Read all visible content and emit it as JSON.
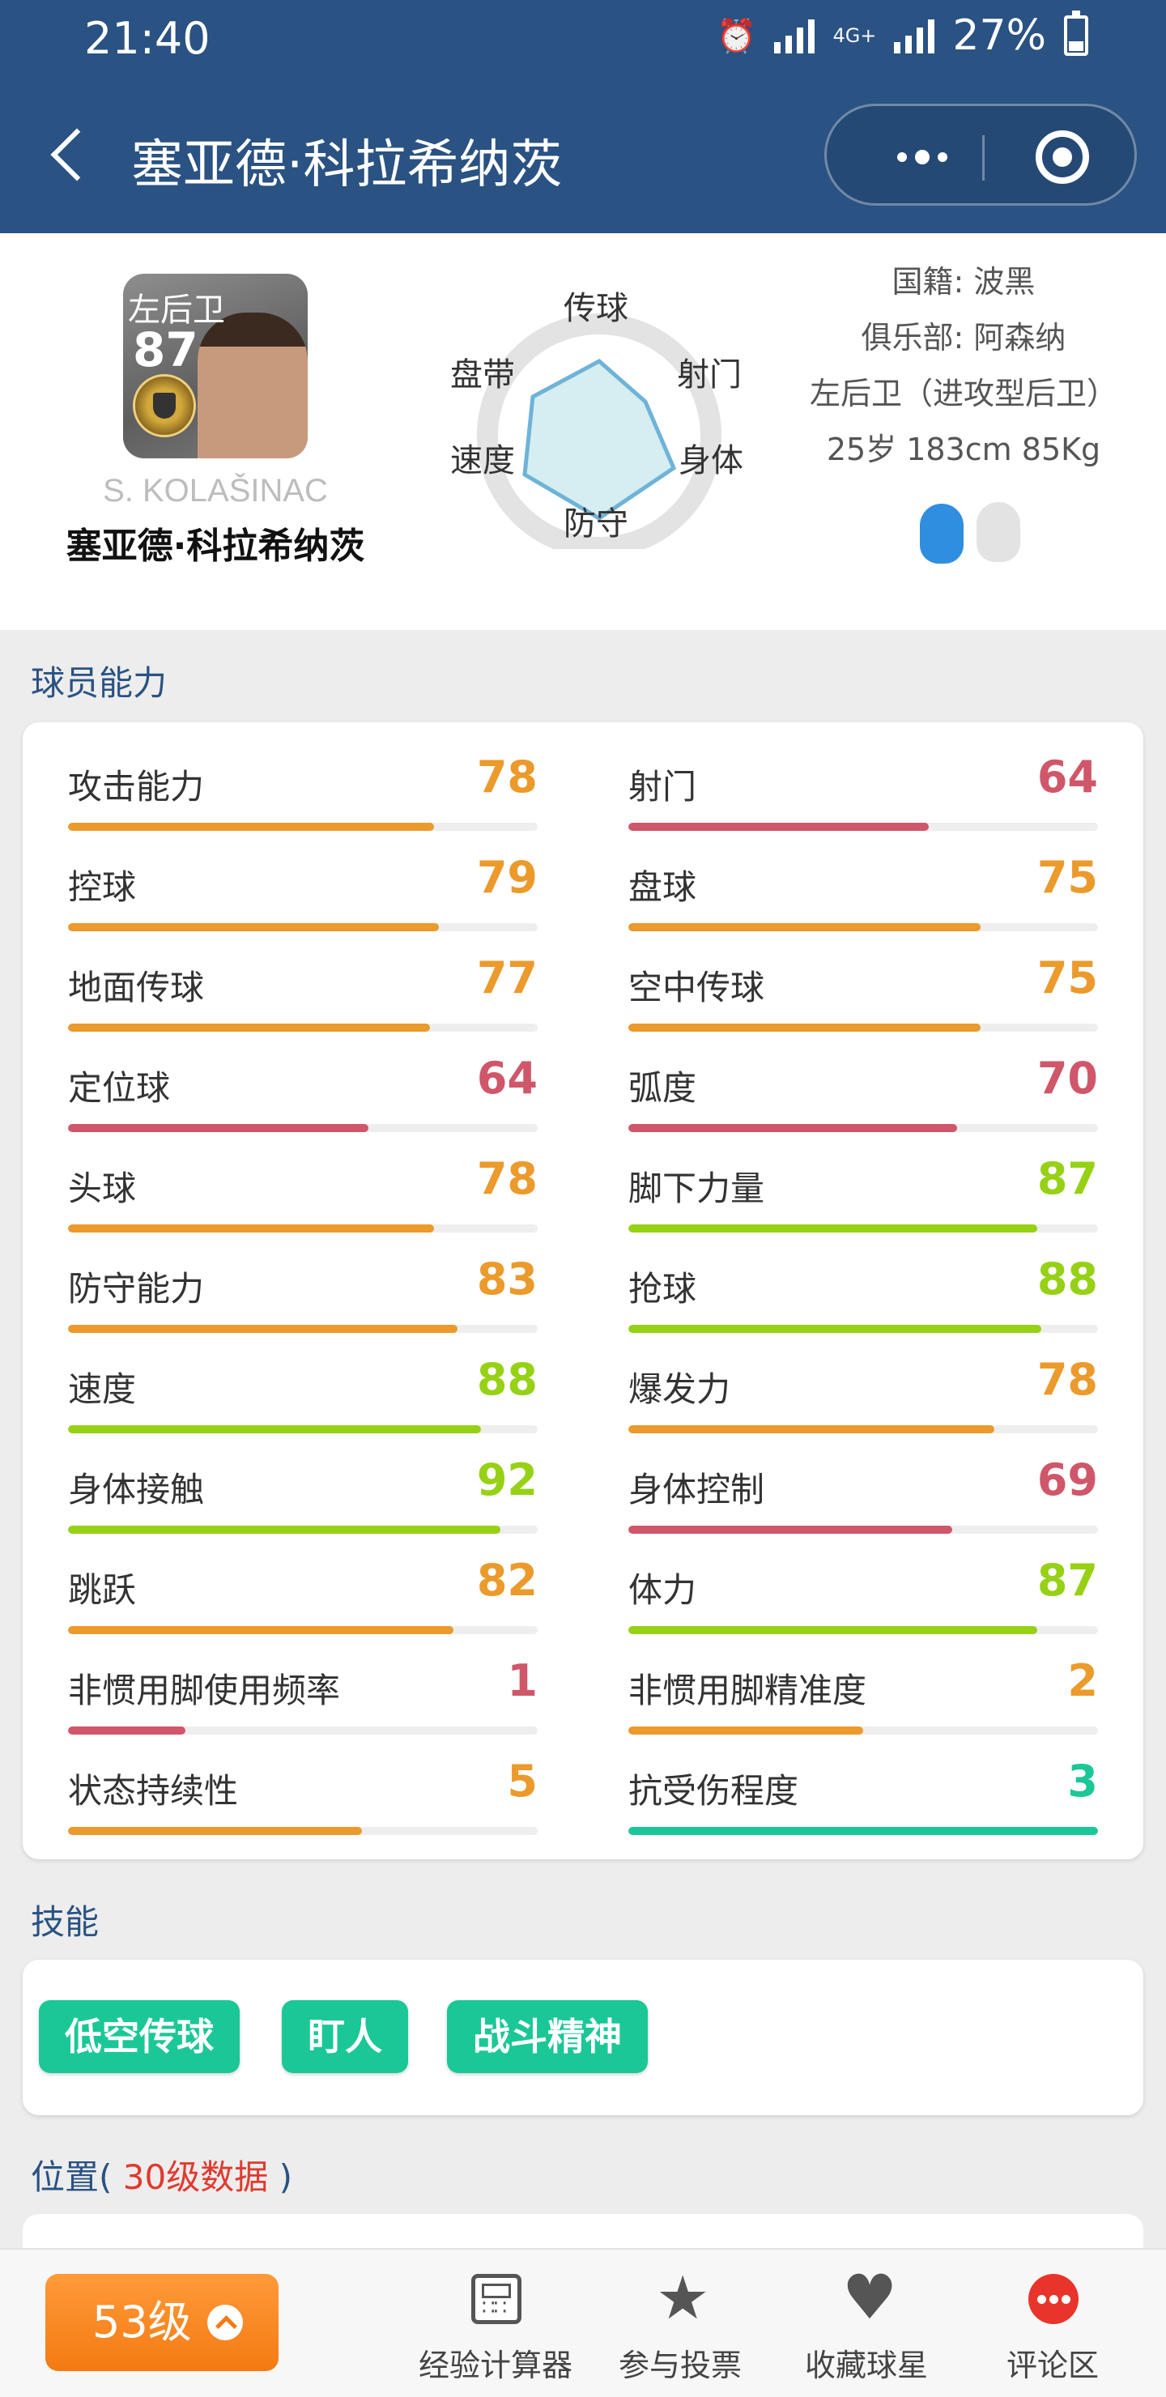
{
  "status": {
    "time": "21:40",
    "battery": "27%",
    "network": "4G+"
  },
  "header": {
    "title": "塞亚德·科拉希纳茨"
  },
  "player": {
    "card_position": "左后卫",
    "overall": "87",
    "name_en": "S. KOLAŠINAC",
    "name_cn": "塞亚德·科拉希纳茨",
    "nationality": "国籍: 波黑",
    "club": "俱乐部: 阿森纳",
    "position_detail": "左后卫（进攻型后卫）",
    "physical": "25岁 183cm 85Kg",
    "foot_icons": [
      "left-foot-icon",
      "right-foot-icon"
    ],
    "radar_labels": {
      "top": "传球",
      "upper_right": "射门",
      "lower_right": "身体",
      "bottom": "防守",
      "lower_left": "速度",
      "upper_left": "盘带"
    }
  },
  "sections": {
    "abilities": "球员能力",
    "skills": "技能",
    "position_prefix": "位置(",
    "position_tag": "30级数据",
    "position_suffix": ")"
  },
  "colors": {
    "orange": "#eb9a2b",
    "red": "#d0566a",
    "green": "#96d116",
    "teal": "#1bc797",
    "header": "#2a5283"
  },
  "stats": {
    "left": [
      {
        "name": "攻击能力",
        "value": "78",
        "fill": 0.78,
        "color": "orange"
      },
      {
        "name": "控球",
        "value": "79",
        "fill": 0.79,
        "color": "orange"
      },
      {
        "name": "地面传球",
        "value": "77",
        "fill": 0.77,
        "color": "orange"
      },
      {
        "name": "定位球",
        "value": "64",
        "fill": 0.64,
        "color": "red"
      },
      {
        "name": "头球",
        "value": "78",
        "fill": 0.78,
        "color": "orange"
      },
      {
        "name": "防守能力",
        "value": "83",
        "fill": 0.83,
        "color": "orange"
      },
      {
        "name": "速度",
        "value": "88",
        "fill": 0.88,
        "color": "green"
      },
      {
        "name": "身体接触",
        "value": "92",
        "fill": 0.92,
        "color": "green"
      },
      {
        "name": "跳跃",
        "value": "82",
        "fill": 0.82,
        "color": "orange"
      },
      {
        "name": "非惯用脚使用频率",
        "value": "1",
        "fill": 0.25,
        "color": "red"
      },
      {
        "name": "状态持续性",
        "value": "5",
        "fill": 0.625,
        "color": "orange"
      }
    ],
    "right": [
      {
        "name": "射门",
        "value": "64",
        "fill": 0.64,
        "color": "red"
      },
      {
        "name": "盘球",
        "value": "75",
        "fill": 0.75,
        "color": "orange"
      },
      {
        "name": "空中传球",
        "value": "75",
        "fill": 0.75,
        "color": "orange"
      },
      {
        "name": "弧度",
        "value": "70",
        "fill": 0.7,
        "color": "red"
      },
      {
        "name": "脚下力量",
        "value": "87",
        "fill": 0.87,
        "color": "green"
      },
      {
        "name": "抢球",
        "value": "88",
        "fill": 0.88,
        "color": "green"
      },
      {
        "name": "爆发力",
        "value": "78",
        "fill": 0.78,
        "color": "orange"
      },
      {
        "name": "身体控制",
        "value": "69",
        "fill": 0.69,
        "color": "red"
      },
      {
        "name": "体力",
        "value": "87",
        "fill": 0.87,
        "color": "green"
      },
      {
        "name": "非惯用脚精准度",
        "value": "2",
        "fill": 0.5,
        "color": "orange"
      },
      {
        "name": "抗受伤程度",
        "value": "3",
        "fill": 1.0,
        "color": "teal"
      }
    ]
  },
  "skills": [
    "低空传球",
    "盯人",
    "战斗精神"
  ],
  "bottom": {
    "level": "53级",
    "tabs": [
      "经验计算器",
      "参与投票",
      "收藏球星",
      "评论区"
    ]
  }
}
